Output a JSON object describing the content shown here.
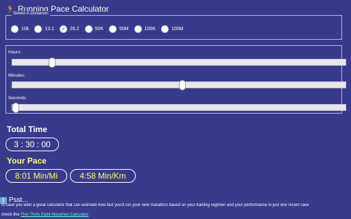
{
  "header": {
    "title": "Running Pace Calculator",
    "icon": "runner-icon"
  },
  "distance": {
    "legend": "Select A Distance:",
    "options": [
      "10k",
      "13.1",
      "26.2",
      "50K",
      "50M",
      "100K",
      "100M"
    ],
    "selected": "26.2"
  },
  "sliders": {
    "hours": {
      "label": "Hours:",
      "fraction": 0.12
    },
    "minutes": {
      "label": "Minutes:",
      "fraction": 0.51
    },
    "seconds": {
      "label": "Seconds:",
      "fraction": 0.0
    }
  },
  "results": {
    "total_time_heading": "Total Time",
    "total_time_value": "3 : 30 : 00",
    "pace_heading": "Your Pace",
    "pace_per_mile": "8:01 Min/Mi",
    "pace_per_km": "4:58 Min/Km"
  },
  "footer": {
    "psst": "Psst...",
    "body": "In case you wish a great calculator that can estimate how fast you'd run your next marathon based on your training regimen and your performance in just one recent race",
    "check_prefix": "check this",
    "link_text": "Five Thirty Eight Marathon Calculator"
  },
  "colors": {
    "background": "#3a3a8c",
    "accent_yellow": "#ffff66",
    "link": "#66ffcc"
  }
}
